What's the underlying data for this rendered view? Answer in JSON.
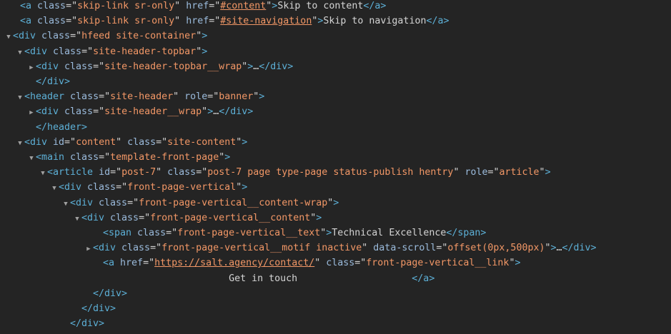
{
  "lines": [
    {
      "indent": 16,
      "twisty": "",
      "parts": [
        {
          "t": "tag",
          "v": "<a "
        },
        {
          "t": "attr",
          "v": "class"
        },
        {
          "t": "eq",
          "v": "=\""
        },
        {
          "t": "val",
          "v": "skip-link sr-only"
        },
        {
          "t": "eq",
          "v": "\" "
        },
        {
          "t": "attr",
          "v": "href"
        },
        {
          "t": "eq",
          "v": "=\""
        },
        {
          "t": "link",
          "v": "#content"
        },
        {
          "t": "eq",
          "v": "\""
        },
        {
          "t": "tag",
          "v": ">"
        },
        {
          "t": "txt",
          "v": "Skip to content"
        },
        {
          "t": "tag",
          "v": "</a>"
        }
      ]
    },
    {
      "indent": 16,
      "twisty": "",
      "parts": [
        {
          "t": "tag",
          "v": "<a "
        },
        {
          "t": "attr",
          "v": "class"
        },
        {
          "t": "eq",
          "v": "=\""
        },
        {
          "t": "val",
          "v": "skip-link sr-only"
        },
        {
          "t": "eq",
          "v": "\" "
        },
        {
          "t": "attr",
          "v": "href"
        },
        {
          "t": "eq",
          "v": "=\""
        },
        {
          "t": "link",
          "v": "#site-navigation"
        },
        {
          "t": "eq",
          "v": "\""
        },
        {
          "t": "tag",
          "v": ">"
        },
        {
          "t": "txt",
          "v": "Skip to navigation"
        },
        {
          "t": "tag",
          "v": "</a>"
        }
      ]
    },
    {
      "indent": 6,
      "twisty": "▼",
      "parts": [
        {
          "t": "tag",
          "v": "<div "
        },
        {
          "t": "attr",
          "v": "class"
        },
        {
          "t": "eq",
          "v": "=\""
        },
        {
          "t": "val",
          "v": "hfeed site-container"
        },
        {
          "t": "eq",
          "v": "\""
        },
        {
          "t": "tag",
          "v": ">"
        }
      ]
    },
    {
      "indent": 22,
      "twisty": "▼",
      "parts": [
        {
          "t": "tag",
          "v": "<div "
        },
        {
          "t": "attr",
          "v": "class"
        },
        {
          "t": "eq",
          "v": "=\""
        },
        {
          "t": "val",
          "v": "site-header-topbar"
        },
        {
          "t": "eq",
          "v": "\""
        },
        {
          "t": "tag",
          "v": ">"
        }
      ]
    },
    {
      "indent": 38,
      "twisty": "▶",
      "parts": [
        {
          "t": "tag",
          "v": "<div "
        },
        {
          "t": "attr",
          "v": "class"
        },
        {
          "t": "eq",
          "v": "=\""
        },
        {
          "t": "val",
          "v": "site-header-topbar__wrap"
        },
        {
          "t": "eq",
          "v": "\""
        },
        {
          "t": "tag",
          "v": ">"
        },
        {
          "t": "ell",
          "v": "…"
        },
        {
          "t": "tag",
          "v": "</div>"
        }
      ]
    },
    {
      "indent": 38,
      "twisty": "",
      "parts": [
        {
          "t": "tag",
          "v": "</div>"
        }
      ]
    },
    {
      "indent": 22,
      "twisty": "▼",
      "parts": [
        {
          "t": "tag",
          "v": "<header "
        },
        {
          "t": "attr",
          "v": "class"
        },
        {
          "t": "eq",
          "v": "=\""
        },
        {
          "t": "val",
          "v": "site-header"
        },
        {
          "t": "eq",
          "v": "\" "
        },
        {
          "t": "attr",
          "v": "role"
        },
        {
          "t": "eq",
          "v": "=\""
        },
        {
          "t": "val",
          "v": "banner"
        },
        {
          "t": "eq",
          "v": "\""
        },
        {
          "t": "tag",
          "v": ">"
        }
      ]
    },
    {
      "indent": 38,
      "twisty": "▶",
      "parts": [
        {
          "t": "tag",
          "v": "<div "
        },
        {
          "t": "attr",
          "v": "class"
        },
        {
          "t": "eq",
          "v": "=\""
        },
        {
          "t": "val",
          "v": "site-header__wrap"
        },
        {
          "t": "eq",
          "v": "\""
        },
        {
          "t": "tag",
          "v": ">"
        },
        {
          "t": "ell",
          "v": "…"
        },
        {
          "t": "tag",
          "v": "</div>"
        }
      ]
    },
    {
      "indent": 38,
      "twisty": "",
      "parts": [
        {
          "t": "tag",
          "v": "</header>"
        }
      ]
    },
    {
      "indent": 22,
      "twisty": "▼",
      "parts": [
        {
          "t": "tag",
          "v": "<div "
        },
        {
          "t": "attr",
          "v": "id"
        },
        {
          "t": "eq",
          "v": "=\""
        },
        {
          "t": "val",
          "v": "content"
        },
        {
          "t": "eq",
          "v": "\" "
        },
        {
          "t": "attr",
          "v": "class"
        },
        {
          "t": "eq",
          "v": "=\""
        },
        {
          "t": "val",
          "v": "site-content"
        },
        {
          "t": "eq",
          "v": "\""
        },
        {
          "t": "tag",
          "v": ">"
        }
      ]
    },
    {
      "indent": 38,
      "twisty": "▼",
      "parts": [
        {
          "t": "tag",
          "v": "<main "
        },
        {
          "t": "attr",
          "v": "class"
        },
        {
          "t": "eq",
          "v": "=\""
        },
        {
          "t": "val",
          "v": "template-front-page"
        },
        {
          "t": "eq",
          "v": "\""
        },
        {
          "t": "tag",
          "v": ">"
        }
      ]
    },
    {
      "indent": 54,
      "twisty": "▼",
      "parts": [
        {
          "t": "tag",
          "v": "<article "
        },
        {
          "t": "attr",
          "v": "id"
        },
        {
          "t": "eq",
          "v": "=\""
        },
        {
          "t": "val",
          "v": "post-7"
        },
        {
          "t": "eq",
          "v": "\" "
        },
        {
          "t": "attr",
          "v": "class"
        },
        {
          "t": "eq",
          "v": "=\""
        },
        {
          "t": "val",
          "v": "post-7 page type-page status-publish hentry"
        },
        {
          "t": "eq",
          "v": "\" "
        },
        {
          "t": "attr",
          "v": "role"
        },
        {
          "t": "eq",
          "v": "=\""
        },
        {
          "t": "val",
          "v": "article"
        },
        {
          "t": "eq",
          "v": "\""
        },
        {
          "t": "tag",
          "v": ">"
        }
      ]
    },
    {
      "indent": 70,
      "twisty": "▼",
      "parts": [
        {
          "t": "tag",
          "v": "<div "
        },
        {
          "t": "attr",
          "v": "class"
        },
        {
          "t": "eq",
          "v": "=\""
        },
        {
          "t": "val",
          "v": "front-page-vertical"
        },
        {
          "t": "eq",
          "v": "\""
        },
        {
          "t": "tag",
          "v": ">"
        }
      ]
    },
    {
      "indent": 86,
      "twisty": "▼",
      "parts": [
        {
          "t": "tag",
          "v": "<div "
        },
        {
          "t": "attr",
          "v": "class"
        },
        {
          "t": "eq",
          "v": "=\""
        },
        {
          "t": "val",
          "v": "front-page-vertical__content-wrap"
        },
        {
          "t": "eq",
          "v": "\""
        },
        {
          "t": "tag",
          "v": ">"
        }
      ]
    },
    {
      "indent": 102,
      "twisty": "▼",
      "parts": [
        {
          "t": "tag",
          "v": "<div "
        },
        {
          "t": "attr",
          "v": "class"
        },
        {
          "t": "eq",
          "v": "=\""
        },
        {
          "t": "val",
          "v": "front-page-vertical__content"
        },
        {
          "t": "eq",
          "v": "\""
        },
        {
          "t": "tag",
          "v": ">"
        }
      ]
    },
    {
      "indent": 132,
      "twisty": "",
      "parts": [
        {
          "t": "tag",
          "v": "<span "
        },
        {
          "t": "attr",
          "v": "class"
        },
        {
          "t": "eq",
          "v": "=\""
        },
        {
          "t": "val",
          "v": "front-page-vertical__text"
        },
        {
          "t": "eq",
          "v": "\""
        },
        {
          "t": "tag",
          "v": ">"
        },
        {
          "t": "txt",
          "v": "Technical Excellence"
        },
        {
          "t": "tag",
          "v": "</span>"
        }
      ]
    },
    {
      "indent": 118,
      "twisty": "▶",
      "parts": [
        {
          "t": "tag",
          "v": "<div "
        },
        {
          "t": "attr",
          "v": "class"
        },
        {
          "t": "eq",
          "v": "=\""
        },
        {
          "t": "val",
          "v": "front-page-vertical__motif inactive"
        },
        {
          "t": "eq",
          "v": "\" "
        },
        {
          "t": "attr",
          "v": "data-scroll"
        },
        {
          "t": "eq",
          "v": "=\""
        },
        {
          "t": "val",
          "v": "offset(0px,500px)"
        },
        {
          "t": "eq",
          "v": "\""
        },
        {
          "t": "tag",
          "v": ">"
        },
        {
          "t": "ell",
          "v": "…"
        },
        {
          "t": "tag",
          "v": "</div>"
        }
      ]
    },
    {
      "indent": 132,
      "twisty": "",
      "parts": [
        {
          "t": "tag",
          "v": "<a "
        },
        {
          "t": "attr",
          "v": "href"
        },
        {
          "t": "eq",
          "v": "=\""
        },
        {
          "t": "link",
          "v": "https://salt.agency/contact/"
        },
        {
          "t": "eq",
          "v": "\" "
        },
        {
          "t": "attr",
          "v": "class"
        },
        {
          "t": "eq",
          "v": "=\""
        },
        {
          "t": "val",
          "v": "front-page-vertical__link"
        },
        {
          "t": "eq",
          "v": "\""
        },
        {
          "t": "tag",
          "v": ">"
        }
      ]
    },
    {
      "indent": 132,
      "twisty": "",
      "parts": [
        {
          "t": "txt",
          "v": "                      Get in touch                    "
        },
        {
          "t": "tag",
          "v": "</a>"
        }
      ]
    },
    {
      "indent": 118,
      "twisty": "",
      "parts": [
        {
          "t": "tag",
          "v": "</div>"
        }
      ]
    },
    {
      "indent": 102,
      "twisty": "",
      "parts": [
        {
          "t": "tag",
          "v": "</div>"
        }
      ]
    },
    {
      "indent": 86,
      "twisty": "",
      "parts": [
        {
          "t": "tag",
          "v": "</div>"
        }
      ]
    }
  ]
}
